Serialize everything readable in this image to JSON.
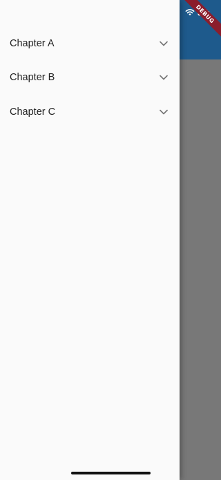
{
  "debug_banner": "DEBUG",
  "icons": {
    "wifi": "wifi-icon",
    "battery": "battery-icon",
    "chevron": "chevron-down-icon"
  },
  "colors": {
    "appbar": "#1e5a8c",
    "drawer": "#fafafa",
    "scrim": "#787878",
    "debug": "#8b1d2c"
  },
  "drawer": {
    "items": [
      {
        "label": "Chapter A"
      },
      {
        "label": "Chapter B"
      },
      {
        "label": "Chapter C"
      }
    ]
  }
}
